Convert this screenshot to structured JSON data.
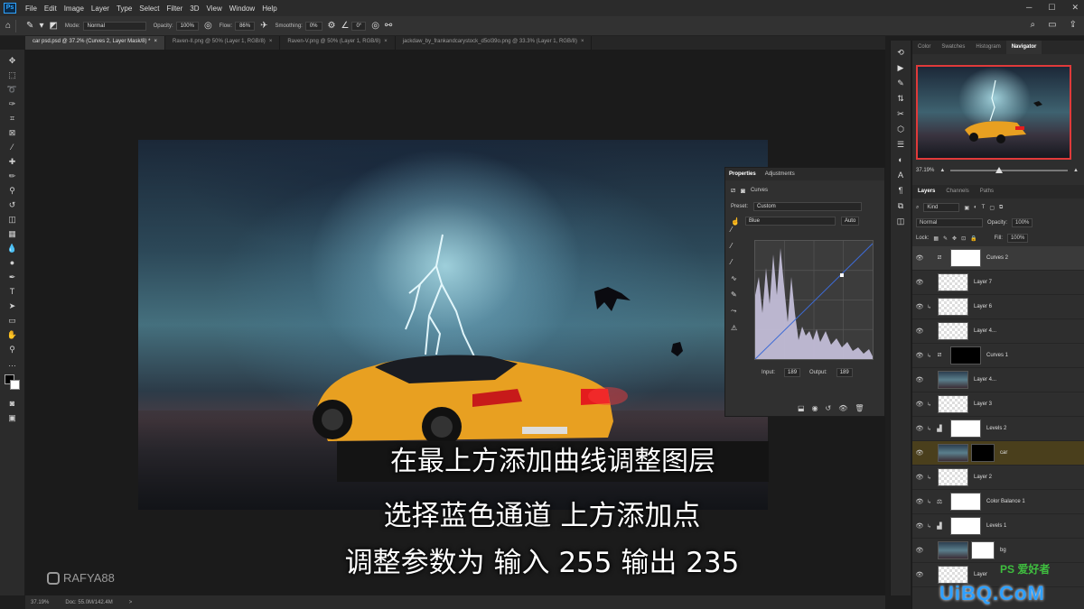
{
  "menu": [
    "File",
    "Edit",
    "Image",
    "Layer",
    "Type",
    "Select",
    "Filter",
    "3D",
    "View",
    "Window",
    "Help"
  ],
  "app_badge": "Ps",
  "options": {
    "mode_label": "Mode:",
    "mode": "Normal",
    "opacity_label": "Opacity:",
    "opacity": "100%",
    "flow_label": "Flow:",
    "flow": "86%",
    "smoothing_label": "Smoothing:",
    "smoothing": "0%",
    "angle": "0°"
  },
  "tabs": [
    {
      "label": "car psd.psd @ 37.2% (Curves 2, Layer Mask/8) *"
    },
    {
      "label": "Raven-II.png @ 50% (Layer 1, RGB/8)"
    },
    {
      "label": "Raven-V.png @ 50% (Layer 1, RGB/8)"
    },
    {
      "label": "jackdaw_by_frankandcarystock_d5ol39o.png @ 33.3% (Layer 1, RGB/8)"
    }
  ],
  "tab_close": "×",
  "status": {
    "zoom": "37.19%",
    "doc": "Doc: 55.0M/142.4M",
    "arrow": ">"
  },
  "subtitles": [
    "在最上方添加曲线调整图层",
    "选择蓝色通道 上方添加点",
    "调整参数为 输入 255 输出 235"
  ],
  "watermark": "RAFYA88",
  "properties": {
    "tabs": [
      "Properties",
      "Adjustments"
    ],
    "title": "Curves",
    "preset_label": "Preset:",
    "preset": "Custom",
    "channel": "Blue",
    "auto": "Auto",
    "input_label": "Input:",
    "input": "189",
    "output_label": "Output:",
    "output": "189"
  },
  "navigator": {
    "tabs": [
      "Color",
      "Swatches",
      "Histogram",
      "Navigator"
    ],
    "zoom": "37.19%"
  },
  "layers_panel": {
    "tabs": [
      "Layers",
      "Channels",
      "Paths"
    ],
    "kind": "Kind",
    "blend": "Normal",
    "opacity_label": "Opacity:",
    "opacity": "100%",
    "lock_label": "Lock:",
    "fill_label": "Fill:",
    "fill": "100%",
    "layers": [
      {
        "name": "Curves 2"
      },
      {
        "name": "Layer 7"
      },
      {
        "name": "Layer 6"
      },
      {
        "name": "Layer 4..."
      },
      {
        "name": "Curves 1"
      },
      {
        "name": "Layer 4..."
      },
      {
        "name": "Layer 3"
      },
      {
        "name": "Levels 2"
      },
      {
        "name": "car"
      },
      {
        "name": "Layer 2"
      },
      {
        "name": "Color Balance 1"
      },
      {
        "name": "Levels 1"
      },
      {
        "name": "bg"
      },
      {
        "name": "Layer"
      }
    ]
  },
  "site_badge": "UiBQ.CoM",
  "ps_badge": "PS 爱好者"
}
